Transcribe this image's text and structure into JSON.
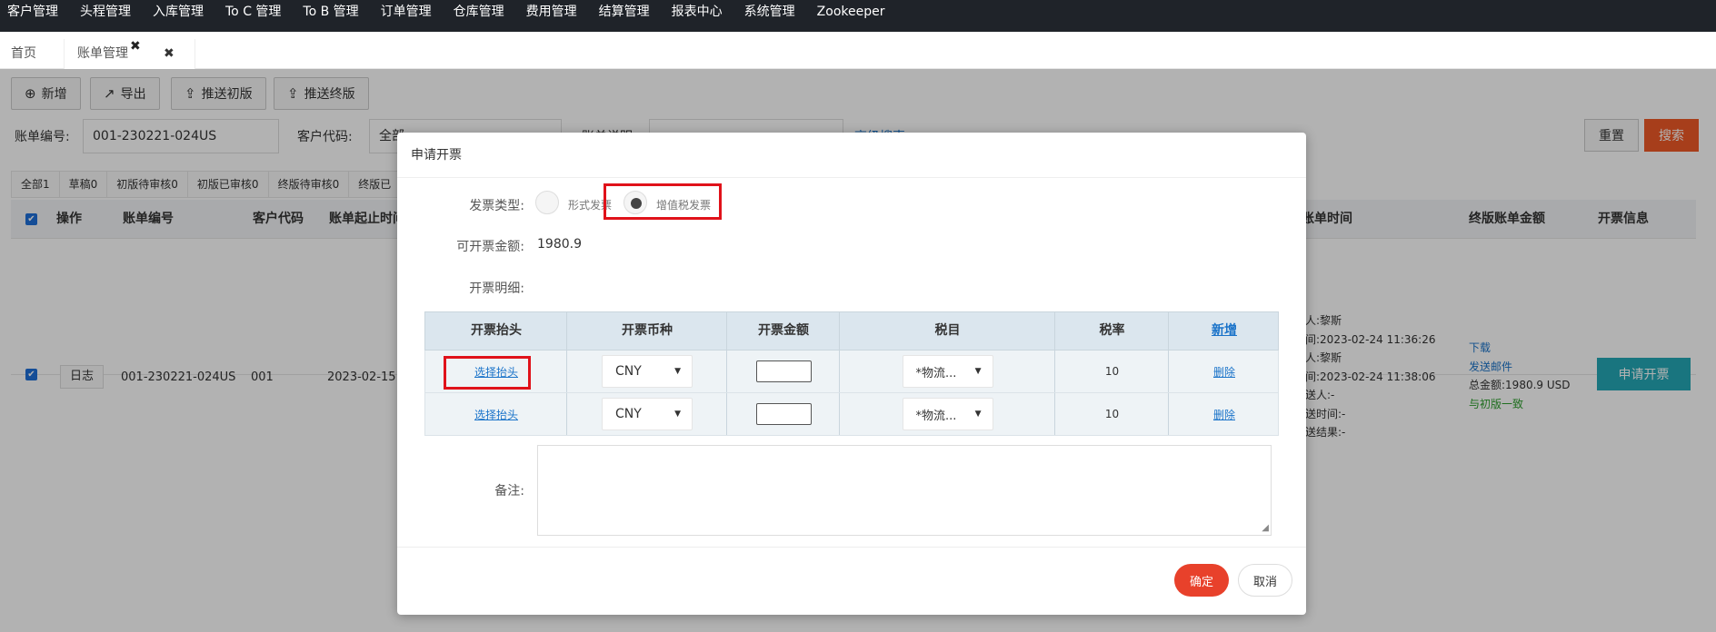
{
  "topnav": [
    "客户管理",
    "头程管理",
    "入库管理",
    "To C 管理",
    "To B 管理",
    "订单管理",
    "仓库管理",
    "费用管理",
    "结算管理",
    "报表中心",
    "系统管理",
    "Zookeeper"
  ],
  "tabs": {
    "home": "首页",
    "bill": "账单管理",
    "tab_close_icon": "✖",
    "close_icon": "✖"
  },
  "toolbar": {
    "add": "新增",
    "export": "导出",
    "push_draft": "推送初版",
    "push_final": "推送终版"
  },
  "search": {
    "bill_no_label": "账单编号:",
    "bill_no_value": "001-230221-024US",
    "customer_label": "客户代码:",
    "customer_value": "全部",
    "desc_label": "账单说明",
    "advanced": "高级搜索",
    "reset": "重置",
    "search": "搜索"
  },
  "status_tabs": [
    "全部1",
    "草稿0",
    "初版待审核0",
    "初版已审核0",
    "终版待审核0",
    "终版已"
  ],
  "table": {
    "headers": {
      "op": "操作",
      "bill_no": "账单编号",
      "customer": "客户代码",
      "range": "账单起止时间",
      "bill_time": "账单时间",
      "final_amount": "终版账单金额",
      "invoice_info": "开票信息"
    },
    "row": {
      "log": "日志",
      "bill_no": "001-230221-024US",
      "customer": "001",
      "range": "2023-02-15 ~",
      "time_lines": [
        "人:黎斯",
        "间:2023-02-24 11:36:26",
        "人:黎斯",
        "间:2023-02-24 11:38:06",
        "送人:-",
        "送时间:-",
        "送结果:-"
      ],
      "download": "下载",
      "send_mail": "发送邮件",
      "total": "总金额:1980.9 USD",
      "consistent": "与初版一致",
      "apply_invoice": "申请开票"
    }
  },
  "modal": {
    "title": "申请开票",
    "invoice_type_label": "发票类型:",
    "opt_formal": "形式发票",
    "opt_vat": "增值税发票",
    "amount_label": "可开票金额:",
    "amount_value": "1980.9",
    "detail_label": "开票明细:",
    "headers": {
      "title": "开票抬头",
      "currency": "开票币种",
      "amount": "开票金额",
      "tax_item": "税目",
      "tax_rate": "税率",
      "add": "新增"
    },
    "rows": [
      {
        "title": "选择抬头",
        "currency": "CNY",
        "tax_item": "*物流...",
        "tax_rate": "10",
        "delete": "删除"
      },
      {
        "title": "选择抬头",
        "currency": "CNY",
        "tax_item": "*物流...",
        "tax_rate": "10",
        "delete": "删除"
      }
    ],
    "remark_label": "备注:",
    "ok": "确定",
    "cancel": "取消"
  },
  "colors": {
    "accent": "#e8412b",
    "search": "#f05a28",
    "invoice_button": "#25a8b7",
    "highlight": "#e0121a"
  }
}
